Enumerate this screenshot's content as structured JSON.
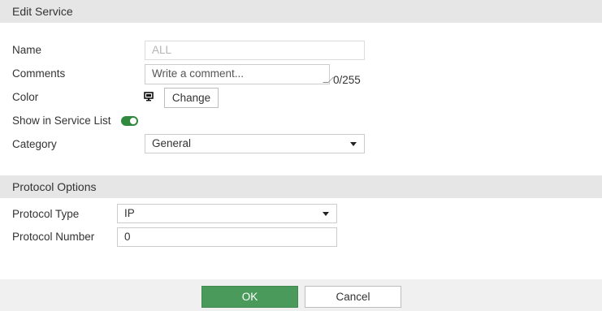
{
  "dialog": {
    "title": "Edit Service"
  },
  "form": {
    "name": {
      "label": "Name",
      "value": "ALL"
    },
    "comments": {
      "label": "Comments",
      "placeholder": "Write a comment...",
      "counter": "0/255"
    },
    "color": {
      "label": "Color",
      "icon": "monitor-icon",
      "button_label": "Change"
    },
    "show_in_list": {
      "label": "Show in Service List",
      "enabled": true
    },
    "category": {
      "label": "Category",
      "value": "General"
    }
  },
  "protocol": {
    "section_title": "Protocol Options",
    "type": {
      "label": "Protocol Type",
      "value": "IP"
    },
    "number": {
      "label": "Protocol Number",
      "value": "0"
    }
  },
  "footer": {
    "ok_label": "OK",
    "cancel_label": "Cancel"
  },
  "colors": {
    "primary": "#4a9a5b",
    "toggle": "#2f8a3f",
    "header_bg": "#e6e6e6"
  }
}
